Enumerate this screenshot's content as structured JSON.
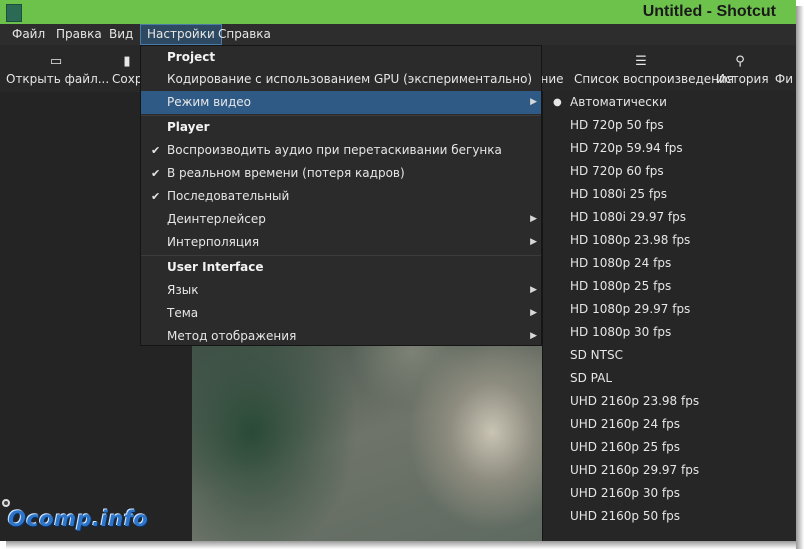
{
  "window": {
    "title": "Untitled - Shotcut"
  },
  "menubar": {
    "items": [
      {
        "label": "Файл"
      },
      {
        "label": "Правка"
      },
      {
        "label": "Вид"
      },
      {
        "label": "Настройки"
      },
      {
        "label": "Справка"
      }
    ]
  },
  "toolbar": {
    "open_label": "Открыть файл...",
    "save_label": "Сохр",
    "partial_label": "ние",
    "playlist_label": "Список воспроизведения",
    "history_label": "История",
    "filters_label": "Фи",
    "icons": {
      "open": "laptop-icon",
      "save": "save-icon",
      "playlist": "list-icon",
      "history": "history-icon"
    }
  },
  "settings_menu": {
    "project_header": "Project",
    "gpu_label": "Кодирование с использованием GPU (экспериментально)",
    "video_mode_label": "Режим видео",
    "player_header": "Player",
    "scrub_audio_label": "Воспроизводить аудио при перетаскивании бегунка",
    "realtime_label": "В реальном времени (потеря кадров)",
    "progressive_label": "Последовательный",
    "deinterlacer_label": "Деинтерлейсер",
    "interpolation_label": "Интерполяция",
    "ui_header": "User Interface",
    "language_label": "Язык",
    "theme_label": "Тема",
    "display_method_label": "Метод отображения",
    "check_glyph": "✔",
    "arrow_glyph": "▶"
  },
  "video_mode_menu": {
    "selected_glyph": "●",
    "items": [
      "Автоматически",
      "HD 720p 50 fps",
      "HD 720p 59.94 fps",
      "HD 720p 60 fps",
      "HD 1080i 25 fps",
      "HD 1080i 29.97 fps",
      "HD 1080p 23.98 fps",
      "HD 1080p 24 fps",
      "HD 1080p 25 fps",
      "HD 1080p 29.97 fps",
      "HD 1080p 30 fps",
      "SD NTSC",
      "SD PAL",
      "UHD 2160p 23.98 fps",
      "UHD 2160p 24 fps",
      "UHD 2160p 25 fps",
      "UHD 2160p 29.97 fps",
      "UHD 2160p 30 fps",
      "UHD 2160p 50 fps"
    ]
  },
  "watermark": "Ocomp.info",
  "colors": {
    "accent": "#6cc24a",
    "highlight": "#2f5a86",
    "watermark": "#2c75c9"
  }
}
